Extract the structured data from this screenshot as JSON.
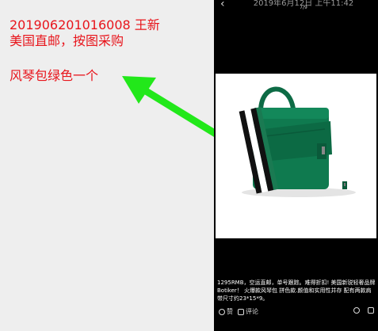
{
  "note": {
    "line1": "201906201016008   王新",
    "line2": "美国直邮，按图采购",
    "line3": "风琴包绿色一个"
  },
  "phone": {
    "title": "2019年6月12日 上午11:42",
    "counter": "7/9",
    "caption": "1295RMB，空运直邮，单号跟踪。难得折扣! 美国新锐轻奢品牌Botiker！ 火爆款风琴包 拼色款.颜值和实用性并存 配有两款肩带尺寸约23*15*9。",
    "actions": {
      "like": "赞",
      "comment": "评论"
    }
  },
  "colors": {
    "note_text": "#e8141b",
    "arrow": "#22e81a",
    "bag_green": "#0f7a4f"
  }
}
